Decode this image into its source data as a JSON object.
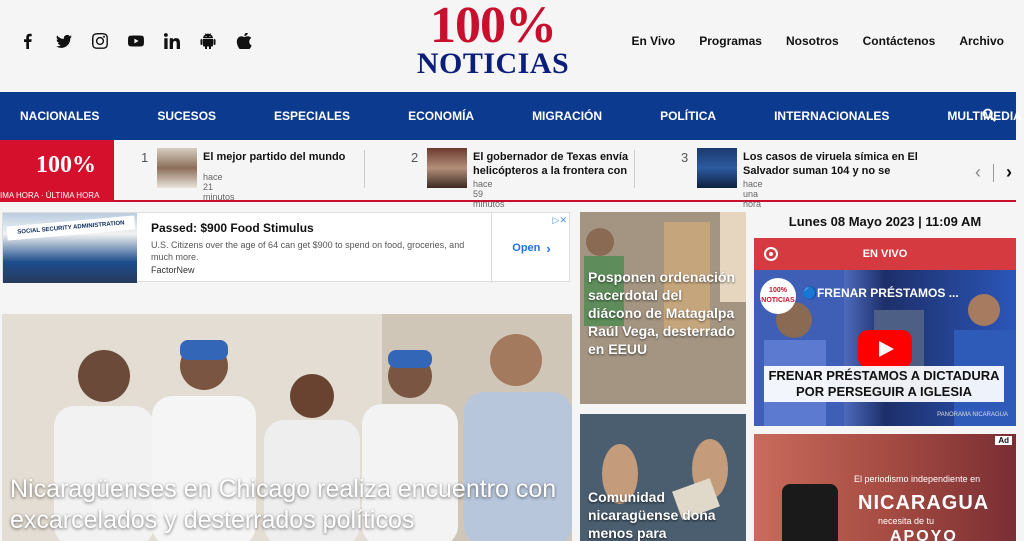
{
  "brand": {
    "logo_line1": "100%",
    "logo_line2": "NOTICIAS"
  },
  "social": [
    "facebook-icon",
    "twitter-icon",
    "instagram-icon",
    "youtube-icon",
    "linkedin-icon",
    "android-icon",
    "apple-icon"
  ],
  "topnav": [
    "En Vivo",
    "Programas",
    "Nosotros",
    "Contáctenos",
    "Archivo"
  ],
  "mainnav": [
    "NACIONALES",
    "SUCESOS",
    "ESPECIALES",
    "ECONOMÍA",
    "MIGRACIÓN",
    "POLÍTICA",
    "INTERNACIONALES",
    "MULTIMEDIA"
  ],
  "ticker": {
    "logo": "100%",
    "label": "IMA HORA · ÚLTIMA HORA",
    "items": [
      {
        "num": "1",
        "title": "El mejor partido del mundo",
        "time": "hace 21 minutos"
      },
      {
        "num": "2",
        "title": "El gobernador de Texas envía helicópteros a la frontera con",
        "time": "hace 59 minutos"
      },
      {
        "num": "3",
        "title": "Los casos de viruela símica en El Salvador suman 104 y no se",
        "time": "hace una hora"
      }
    ],
    "prev": "‹",
    "next": "›"
  },
  "ad": {
    "sign": "SOCIAL SECURITY ADMINISTRATION",
    "headline": "Passed: $900 Food Stimulus",
    "description": "U.S. Citizens over the age of 64 can get $900 to spend on food, groceries, and much more.",
    "brand": "FactorNew",
    "cta": "Open"
  },
  "hero": {
    "title": "Nicaragüenses en Chicago realiza encuentro con excarcelados y desterrados políticos"
  },
  "side_cards": [
    {
      "title": "Posponen ordenación sacerdotal del diácono de Matagalpa Raúl Vega, desterrado en EEUU"
    },
    {
      "title": "Comunidad nicaragüense dona menos para"
    }
  ],
  "datetime": "Lunes 08 Mayo 2023 | 11:09 AM",
  "live": {
    "label": "EN VIVO",
    "logo": "100% NOTICIAS",
    "video_title": "🔵FRENAR PRÉSTAMOS ...",
    "caption": "FRENAR PRÉSTAMOS A DICTADURA POR PERSEGUIR A IGLESIA",
    "watermark": "PANORAMA NICARAGUA"
  },
  "promo": {
    "tag": "Ad",
    "line1": "El periodismo independiente en",
    "line2": "NICARAGUA",
    "line3": "necesita de tu",
    "line4": "APOYO"
  }
}
